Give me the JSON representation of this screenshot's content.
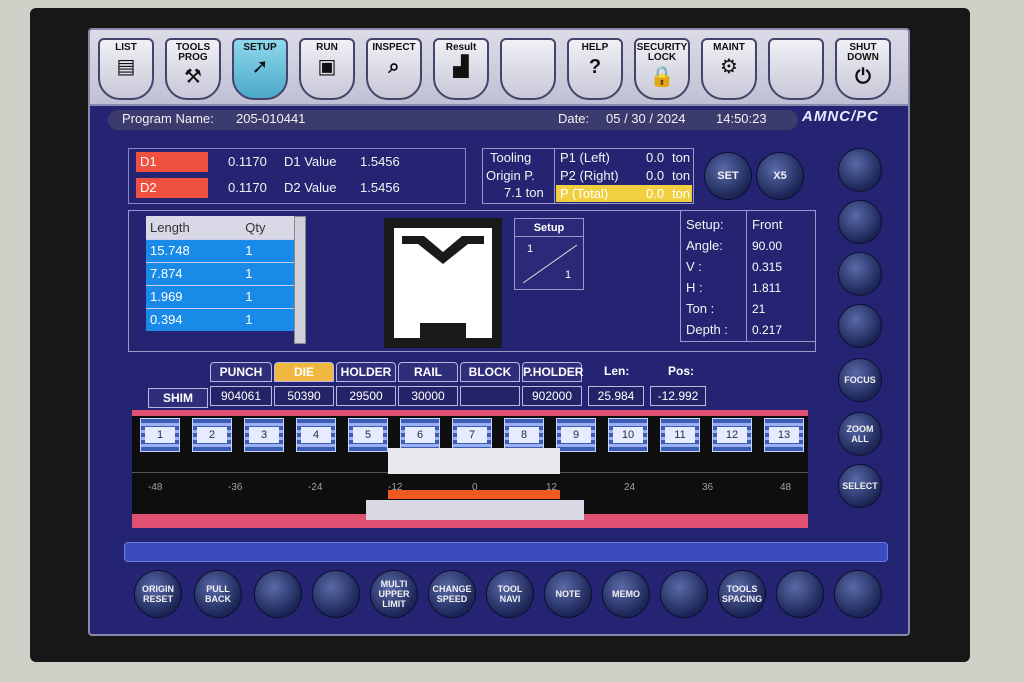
{
  "toolbar": [
    {
      "label": "LIST",
      "icon": "list-icon"
    },
    {
      "label": "TOOLS PROG",
      "icon": "tools-prog-icon"
    },
    {
      "label": "SETUP",
      "icon": "cursor-icon"
    },
    {
      "label": "RUN",
      "icon": "run-icon"
    },
    {
      "label": "INSPECT",
      "icon": "magnifier-icon"
    },
    {
      "label": "Result",
      "icon": "chart-icon"
    },
    {
      "label": "",
      "icon": ""
    },
    {
      "label": "HELP",
      "icon": "question-icon"
    },
    {
      "label": "SECURITY LOCK",
      "icon": "lock-icon"
    },
    {
      "label": "MAINT",
      "icon": "wrench-icon"
    },
    {
      "label": "",
      "icon": ""
    },
    {
      "label": "SHUT DOWN",
      "icon": "shutdown-icon"
    }
  ],
  "header": {
    "program_label": "Program Name:",
    "program_name": "205-010441",
    "date_label": "Date:",
    "date": "05 / 30 / 2024",
    "time": "14:50:23",
    "logo": "AMNC/PC"
  },
  "axes": [
    {
      "name": "D1",
      "value": "0.1170",
      "value_label": "D1 Value",
      "value_val": "1.5456"
    },
    {
      "name": "D2",
      "value": "0.1170",
      "value_label": "D2 Value",
      "value_val": "1.5456"
    }
  ],
  "tooling": {
    "label1": "Tooling",
    "label2": "Origin P.",
    "ton": "7.1 ton"
  },
  "pressure": [
    {
      "label": "P1 (Left)",
      "value": "0.0",
      "unit": "ton"
    },
    {
      "label": "P2 (Right)",
      "value": "0.0",
      "unit": "ton"
    },
    {
      "label": "P (Total)",
      "value": "0.0",
      "unit": "ton"
    }
  ],
  "buttons": {
    "set": "SET",
    "x5": "X5"
  },
  "length_table": {
    "headers": [
      "Length",
      "Qty"
    ],
    "rows": [
      [
        "15.748",
        "1"
      ],
      [
        "7.874",
        "1"
      ],
      [
        "1.969",
        "1"
      ],
      [
        "0.394",
        "1"
      ]
    ]
  },
  "setup_box": {
    "title": "Setup",
    "top": "1",
    "bottom": "1"
  },
  "setup_info": [
    {
      "label": "Setup:",
      "value": "Front"
    },
    {
      "label": "Angle:",
      "value": "90.00"
    },
    {
      "label": "V :",
      "value": "0.315"
    },
    {
      "label": "H :",
      "value": "1.811"
    },
    {
      "label": "Ton :",
      "value": "21"
    },
    {
      "label": "Depth :",
      "value": "0.217"
    }
  ],
  "tabs": [
    "PUNCH",
    "DIE",
    "HOLDER",
    "RAIL",
    "BLOCK",
    "P.HOLDER"
  ],
  "len_label": "Len:",
  "pos_label": "Pos:",
  "shim": {
    "label": "SHIM",
    "values": [
      "904061",
      "50390",
      "29500",
      "30000",
      "",
      "902000"
    ],
    "len": "25.984",
    "pos": "-12.992"
  },
  "segments": [
    "1",
    "2",
    "3",
    "4",
    "5",
    "6",
    "7",
    "8",
    "9",
    "10",
    "11",
    "12",
    "13"
  ],
  "ruler": [
    "-48",
    "-36",
    "-24",
    "-12",
    "0",
    "12",
    "24",
    "36",
    "48"
  ],
  "side": {
    "focus": "FOCUS",
    "zoom": "ZOOM ALL",
    "select": "SELECT"
  },
  "bottom_buttons": [
    "ORIGIN RESET",
    "PULL BACK",
    "",
    "",
    "MULTI UPPER LIMIT",
    "CHANGE SPEED",
    "TOOL NAVI",
    "NOTE",
    "MEMO",
    "",
    "TOOLS SPACING",
    "",
    ""
  ],
  "colors": {
    "screen": "#242472",
    "red": "#f05040",
    "blue_cell": "#1a8ae8",
    "yellow": "#f0d040",
    "orange": "#f0b840"
  }
}
